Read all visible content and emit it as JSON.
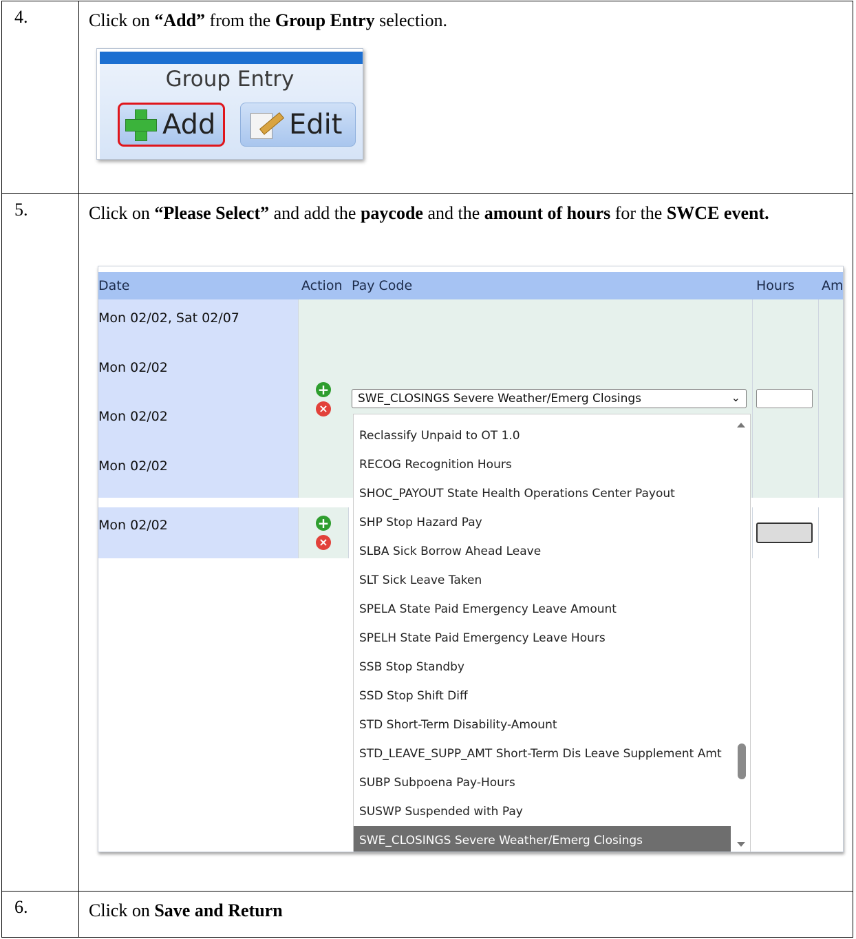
{
  "steps": [
    {
      "number": "4.",
      "instruction": [
        {
          "t": "Click on ",
          "b": false
        },
        {
          "t": "“Add”",
          "b": true
        },
        {
          "t": " from the ",
          "b": false
        },
        {
          "t": "Group Entry",
          "b": true
        },
        {
          "t": " selection.",
          "b": false
        }
      ]
    },
    {
      "number": "5.",
      "instruction": [
        {
          "t": "Click on ",
          "b": false
        },
        {
          "t": "“Please Select”",
          "b": true
        },
        {
          "t": " and add the ",
          "b": false
        },
        {
          "t": "paycode",
          "b": true
        },
        {
          "t": " and the ",
          "b": false
        },
        {
          "t": "amount of hours",
          "b": true
        },
        {
          "t": " for the ",
          "b": false
        },
        {
          "t": "SWCE event.",
          "b": true
        }
      ]
    },
    {
      "number": "6.",
      "instruction": [
        {
          "t": "Click on ",
          "b": false
        },
        {
          "t": "Save and Return",
          "b": true
        }
      ]
    }
  ],
  "group_entry": {
    "title": "Group Entry",
    "add_label": "Add",
    "edit_label": "Edit"
  },
  "pay_grid": {
    "headers": {
      "date": "Date",
      "action": "Action",
      "pay_code": "Pay Code",
      "hours": "Hours",
      "amount": "Am"
    },
    "dates_block1": [
      "Mon 02/02, Sat 02/07",
      "Mon 02/02",
      "Mon 02/02",
      "Mon 02/02"
    ],
    "date_row2": "Mon 02/02",
    "selected_paycode": "SWE_CLOSINGS Severe Weather/Emerg Closings",
    "dropdown_options": [
      "Reclassify Unpaid to OT 1.0",
      "RECOG Recognition Hours",
      "SHOC_PAYOUT State Health Operations Center Payout",
      "SHP Stop Hazard Pay",
      "SLBA Sick Borrow Ahead Leave",
      "SLT Sick Leave Taken",
      "SPELA State Paid Emergency Leave Amount",
      "SPELH State Paid Emergency Leave Hours",
      "SSB Stop Standby",
      "SSD Stop Shift Diff",
      "STD Short-Term Disability-Amount",
      "STD_LEAVE_SUPP_AMT Short-Term Dis Leave Supplement Amt",
      "SUBP Subpoena Pay-Hours",
      "SUSWP Suspended with Pay",
      "SWE_CLOSINGS Severe Weather/Emerg Closings"
    ],
    "selected_index": 14,
    "colors": {
      "header": "#a6c3f3",
      "date_bg": "#d4e0fb",
      "row_bg": "#e6f1ec",
      "selected": "#6e6e6e"
    }
  }
}
